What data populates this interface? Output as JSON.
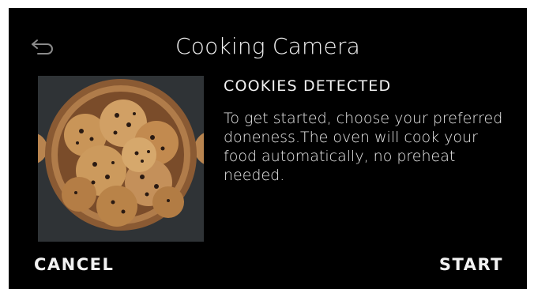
{
  "header": {
    "title": "Cooking Camera",
    "back_icon": "back-arrow-icon"
  },
  "detection": {
    "image_subject": "cookies",
    "headline": "COOKIES DETECTED",
    "description": "To get started, choose your preferred doneness.The oven will cook your food automatically, no preheat needed."
  },
  "actions": {
    "cancel_label": "CANCEL",
    "start_label": "START"
  },
  "colors": {
    "background": "#000000",
    "text": "#f2f2f2",
    "photo_backdrop": "#2f3336"
  }
}
